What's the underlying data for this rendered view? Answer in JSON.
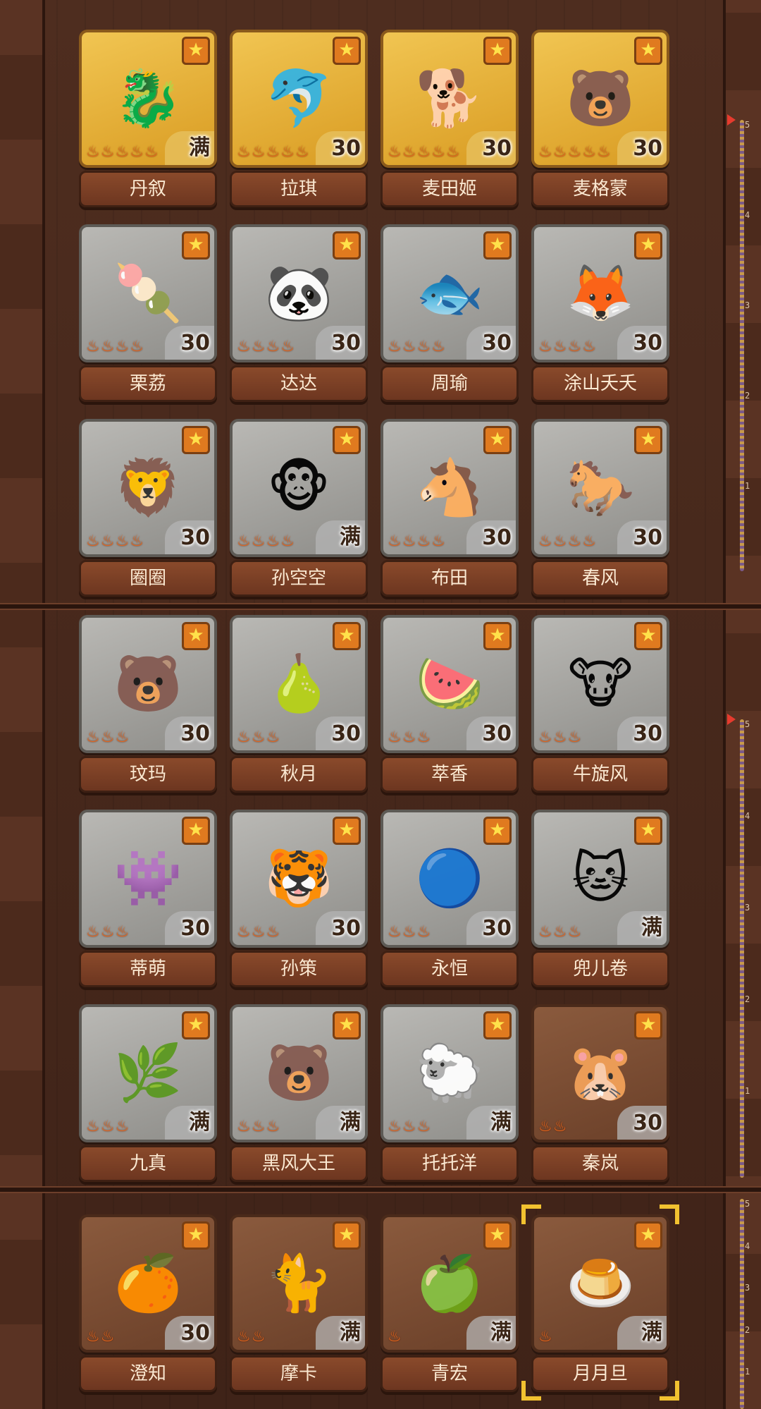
{
  "full_label": "满",
  "star_glyph": "★",
  "flame_glyph": "♨",
  "colors": {
    "gold_tile": "#e3b03a",
    "gray_tile": "#a3a29e",
    "brown_tile": "#7a4c33",
    "name_plate": "#7a3f25",
    "flame": "#e8661c"
  },
  "ruler": {
    "ticks": [
      "5",
      "4",
      "3",
      "2",
      "1"
    ]
  },
  "cards": [
    {
      "name": "丹叙",
      "level": "满",
      "tier": "gold",
      "flames": 5,
      "icon": "dragon-icon",
      "glyph": "🐉"
    },
    {
      "name": "拉琪",
      "level": "30",
      "tier": "gold",
      "flames": 5,
      "icon": "dolphin-icon",
      "glyph": "🐬"
    },
    {
      "name": "麦田姬",
      "level": "30",
      "tier": "gold",
      "flames": 5,
      "icon": "shiba-icon",
      "glyph": "🐕"
    },
    {
      "name": "麦格蒙",
      "level": "30",
      "tier": "gold",
      "flames": 5,
      "icon": "bear-icon",
      "glyph": "🐻"
    },
    {
      "name": "栗荔",
      "level": "30",
      "tier": "gray",
      "flames": 4,
      "icon": "bun-icon",
      "glyph": "🍡"
    },
    {
      "name": "达达",
      "level": "30",
      "tier": "gray",
      "flames": 4,
      "icon": "panda-icon",
      "glyph": "🐼"
    },
    {
      "name": "周瑜",
      "level": "30",
      "tier": "gray",
      "flames": 4,
      "icon": "goldfish-icon",
      "glyph": "🐟"
    },
    {
      "name": "涂山夭夭",
      "level": "30",
      "tier": "gray",
      "flames": 4,
      "icon": "fox-icon",
      "glyph": "🦊"
    },
    {
      "name": "圈圈",
      "level": "30",
      "tier": "gray",
      "flames": 4,
      "icon": "lion-dance-icon",
      "glyph": "🦁"
    },
    {
      "name": "孙空空",
      "level": "满",
      "tier": "gray",
      "flames": 4,
      "icon": "monkey-icon",
      "glyph": "🐵"
    },
    {
      "name": "布田",
      "level": "30",
      "tier": "gray",
      "flames": 4,
      "icon": "horse-icon",
      "glyph": "🐴"
    },
    {
      "name": "春风",
      "level": "30",
      "tier": "gray",
      "flames": 4,
      "icon": "pony-icon",
      "glyph": "🐎"
    },
    {
      "name": "玟玛",
      "level": "30",
      "tier": "gray",
      "flames": 3,
      "icon": "polar-bear-icon",
      "glyph": "🐻"
    },
    {
      "name": "秋月",
      "level": "30",
      "tier": "gray",
      "flames": 3,
      "icon": "pear-icon",
      "glyph": "🍐"
    },
    {
      "name": "萃香",
      "level": "30",
      "tier": "gray",
      "flames": 3,
      "icon": "watermelon-icon",
      "glyph": "🍉"
    },
    {
      "name": "牛旋风",
      "level": "30",
      "tier": "gray",
      "flames": 3,
      "icon": "bull-icon",
      "glyph": "🐮"
    },
    {
      "name": "蒂萌",
      "level": "30",
      "tier": "gray",
      "flames": 3,
      "icon": "dark-creature-icon",
      "glyph": "👾"
    },
    {
      "name": "孙策",
      "level": "30",
      "tier": "gray",
      "flames": 3,
      "icon": "tiger-icon",
      "glyph": "🐯"
    },
    {
      "name": "永恒",
      "level": "30",
      "tier": "gray",
      "flames": 3,
      "icon": "orb-icon",
      "glyph": "🔵"
    },
    {
      "name": "兜儿卷",
      "level": "满",
      "tier": "gray",
      "flames": 3,
      "icon": "cat-icon",
      "glyph": "🐱"
    },
    {
      "name": "九真",
      "level": "满",
      "tier": "gray",
      "flames": 3,
      "icon": "plant-icon",
      "glyph": "🌿"
    },
    {
      "name": "黑风大王",
      "level": "满",
      "tier": "gray",
      "flames": 3,
      "icon": "black-bear-icon",
      "glyph": "🐻"
    },
    {
      "name": "托托洋",
      "level": "满",
      "tier": "gray",
      "flames": 3,
      "icon": "lamb-icon",
      "glyph": "🐑"
    },
    {
      "name": "秦岚",
      "level": "30",
      "tier": "brown",
      "flames": 2,
      "icon": "capybara-icon",
      "glyph": "🐹"
    },
    {
      "name": "澄知",
      "level": "30",
      "tier": "brown",
      "flames": 2,
      "icon": "orange-icon",
      "glyph": "🍊"
    },
    {
      "name": "摩卡",
      "level": "满",
      "tier": "brown",
      "flames": 2,
      "icon": "siamese-cat-icon",
      "glyph": "🐈"
    },
    {
      "name": "青宏",
      "level": "满",
      "tier": "brown",
      "flames": 1,
      "icon": "green-fruit-icon",
      "glyph": "🍏"
    },
    {
      "name": "月月旦",
      "level": "满",
      "tier": "brown",
      "flames": 1,
      "icon": "mochi-icon",
      "glyph": "🍮"
    }
  ]
}
